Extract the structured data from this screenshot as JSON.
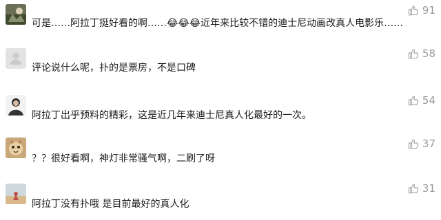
{
  "comments": [
    {
      "text": "可是……阿拉丁挺好看的啊……😂😂😂近年来比较不错的迪士尼动画改真人电影乐……",
      "likes": "91",
      "avatar": "landscape-avatar"
    },
    {
      "text": "评论说什么呢，扑的是票房，不是口碑",
      "likes": "58",
      "avatar": "gray-avatar"
    },
    {
      "text": "阿拉丁出乎预料的精彩，这是近几年来迪士尼真人化最好的一次。",
      "likes": "54",
      "avatar": "person-avatar"
    },
    {
      "text": "？？很好看啊，神灯非常骚气啊，二刷了呀",
      "likes": "37",
      "avatar": "cat-avatar"
    },
    {
      "text": "阿拉丁没有扑哦 是目前最好的真人化",
      "likes": "31",
      "avatar": "beach-avatar"
    }
  ],
  "colors": {
    "text": "#1a1a1a",
    "muted": "#9a9a9a",
    "background": "#ffffff"
  }
}
